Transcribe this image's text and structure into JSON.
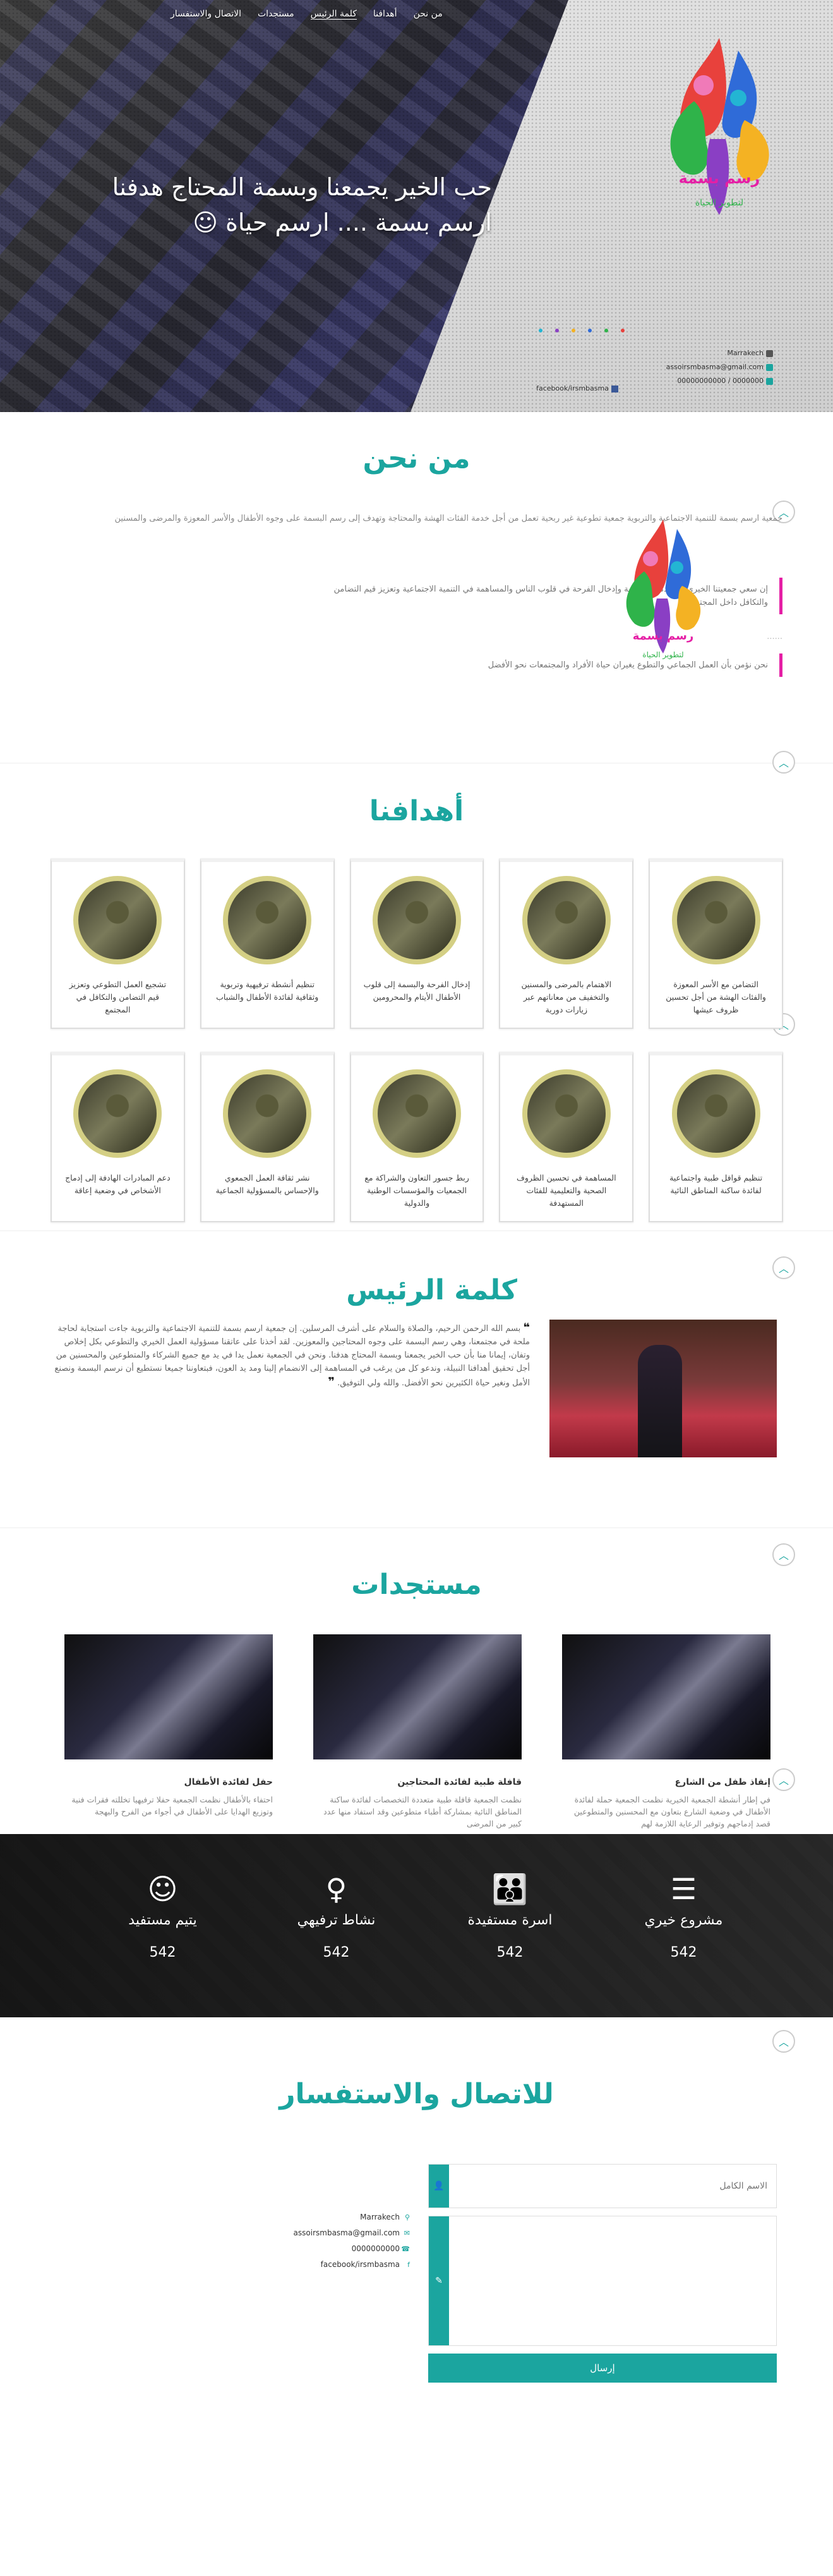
{
  "nav": {
    "items": [
      "من نحن",
      "أهدافنا",
      "كلمة الرئيس",
      "مستجدات",
      "الاتصال والاستفسار"
    ]
  },
  "hero": {
    "slogan_line1": "حب الخير يجمعنا وبسمة المحتاج هدفنا",
    "slogan_line2": "ارسم بسمة .... ارسم حياة ☺",
    "logo_text_top": "رسم بسمة",
    "logo_text_bottom": "لتطوير الحياة",
    "contact_address": "Marrakech",
    "contact_email": "assoirsmbasma@gmail.com",
    "contact_phone": "0000000 / 00000000000",
    "contact_facebook": "facebook/irsmbasma"
  },
  "about": {
    "title": "من نحن",
    "lead": "جمعية ارسم بسمة للتنمية الاجتماعية والتربوية جمعية تطوعية غير ربحية تعمل من أجل خدمة الفئات الهشة والمحتاجة وتهدف إلى رسم البسمة على وجوه الأطفال والأسر المعوزة والمرضى والمسنين",
    "quote1": "إن سعي جمعيتنا الخيري هو خدمة الإنسانية وإدخال الفرحة في قلوب الناس والمساهمة في التنمية الاجتماعية وتعزيز قيم التضامن والتكافل داخل المجتمع",
    "dots": "......",
    "quote2": "نحن نؤمن بأن العمل الجماعي والتطوع يغيران حياة الأفراد والمجتمعات نحو الأفضل",
    "logo_text_top": "رسم بسمة",
    "logo_text_bottom": "لتطوير الحياة"
  },
  "goals": {
    "title": "أهدافنا",
    "items": [
      "التضامن مع الأسر المعوزة والفئات الهشة من أجل تحسين ظروف عيشها",
      "الاهتمام بالمرضى والمسنين والتخفيف من معاناتهم عبر زيارات دورية",
      "إدخال الفرحة والبسمة إلى قلوب الأطفال الأيتام والمحرومين",
      "تنظيم أنشطة ترفيهية وتربوية وثقافية لفائدة الأطفال والشباب",
      "تشجيع العمل التطوعي وتعزيز قيم التضامن والتكافل في المجتمع",
      "تنظيم قوافل طبية واجتماعية لفائدة ساكنة المناطق النائية",
      "المساهمة في تحسين الظروف الصحية والتعليمية للفئات المستهدفة",
      "ربط جسور التعاون والشراكة مع الجمعيات والمؤسسات الوطنية والدولية",
      "نشر ثقافة العمل الجمعوي والإحساس بالمسؤولية الجماعية",
      "دعم المبادرات الهادفة إلى إدماج الأشخاص في وضعية إعاقة"
    ]
  },
  "president": {
    "title": "كلمة الرئيس",
    "quote_mark": "❝",
    "text": "بسم الله الرحمن الرحيم، والصلاة والسلام على أشرف المرسلين. إن جمعية ارسم بسمة للتنمية الاجتماعية والتربوية جاءت استجابة لحاجة ملحة في مجتمعنا، وهي رسم البسمة على وجوه المحتاجين والمعوزين. لقد أخذنا على عاتقنا مسؤولية العمل الخيري والتطوعي بكل إخلاص وتفان، إيمانا منا بأن حب الخير يجمعنا وبسمة المحتاج هدفنا. ونحن في الجمعية نعمل يدا في يد مع جميع الشركاء والمتطوعين والمحسنين من أجل تحقيق أهدافنا النبيلة، وندعو كل من يرغب في المساهمة إلى الانضمام إلينا ومد يد العون، فبتعاوننا جميعا نستطيع أن نرسم البسمة ونصنع الأمل ونغير حياة الكثيرين نحو الأفضل. والله ولي التوفيق.",
    "closing_mark": "❞"
  },
  "news": {
    "title": "مستجدات",
    "items": [
      {
        "title": "إنقاذ طفل من الشارع",
        "body": "في إطار أنشطة الجمعية الخيرية نظمت الجمعية حملة لفائدة الأطفال في وضعية الشارع بتعاون مع المحسنين والمتطوعين قصد إدماجهم وتوفير الرعاية اللازمة لهم"
      },
      {
        "title": "قافلة طبية لفائدة المحتاجين",
        "body": "نظمت الجمعية قافلة طبية متعددة التخصصات لفائدة ساكنة المناطق النائية بمشاركة أطباء متطوعين وقد استفاد منها عدد كبير من المرضى"
      },
      {
        "title": "حفل لفائدة الأطفال",
        "body": "احتفاء بالأطفال نظمت الجمعية حفلا ترفيهيا تخللته فقرات فنية وتوزيع الهدايا على الأطفال في أجواء من الفرح والبهجة"
      }
    ]
  },
  "stats": {
    "items": [
      {
        "icon": "server-icon",
        "label": "مشروع خيري",
        "value": "542"
      },
      {
        "icon": "family-icon",
        "label": "اسرة مستفيدة",
        "value": "542"
      },
      {
        "icon": "woman-icon",
        "label": "نشاط ترفيهي",
        "value": "542"
      },
      {
        "icon": "child-icon",
        "label": "يتيم مستفيد",
        "value": "542"
      }
    ]
  },
  "contact": {
    "title": "للاتصال والاستفسار",
    "name_placeholder": "الاسم الكامل",
    "message_placeholder": "",
    "send_label": "إرسال",
    "address": "Marrakech",
    "email": "assoirsmbasma@gmail.com",
    "phone": "0000000000",
    "facebook": "facebook/irsmbasma"
  },
  "colors": {
    "accent": "#1ba59f",
    "quote_border": "#e51fa5"
  }
}
